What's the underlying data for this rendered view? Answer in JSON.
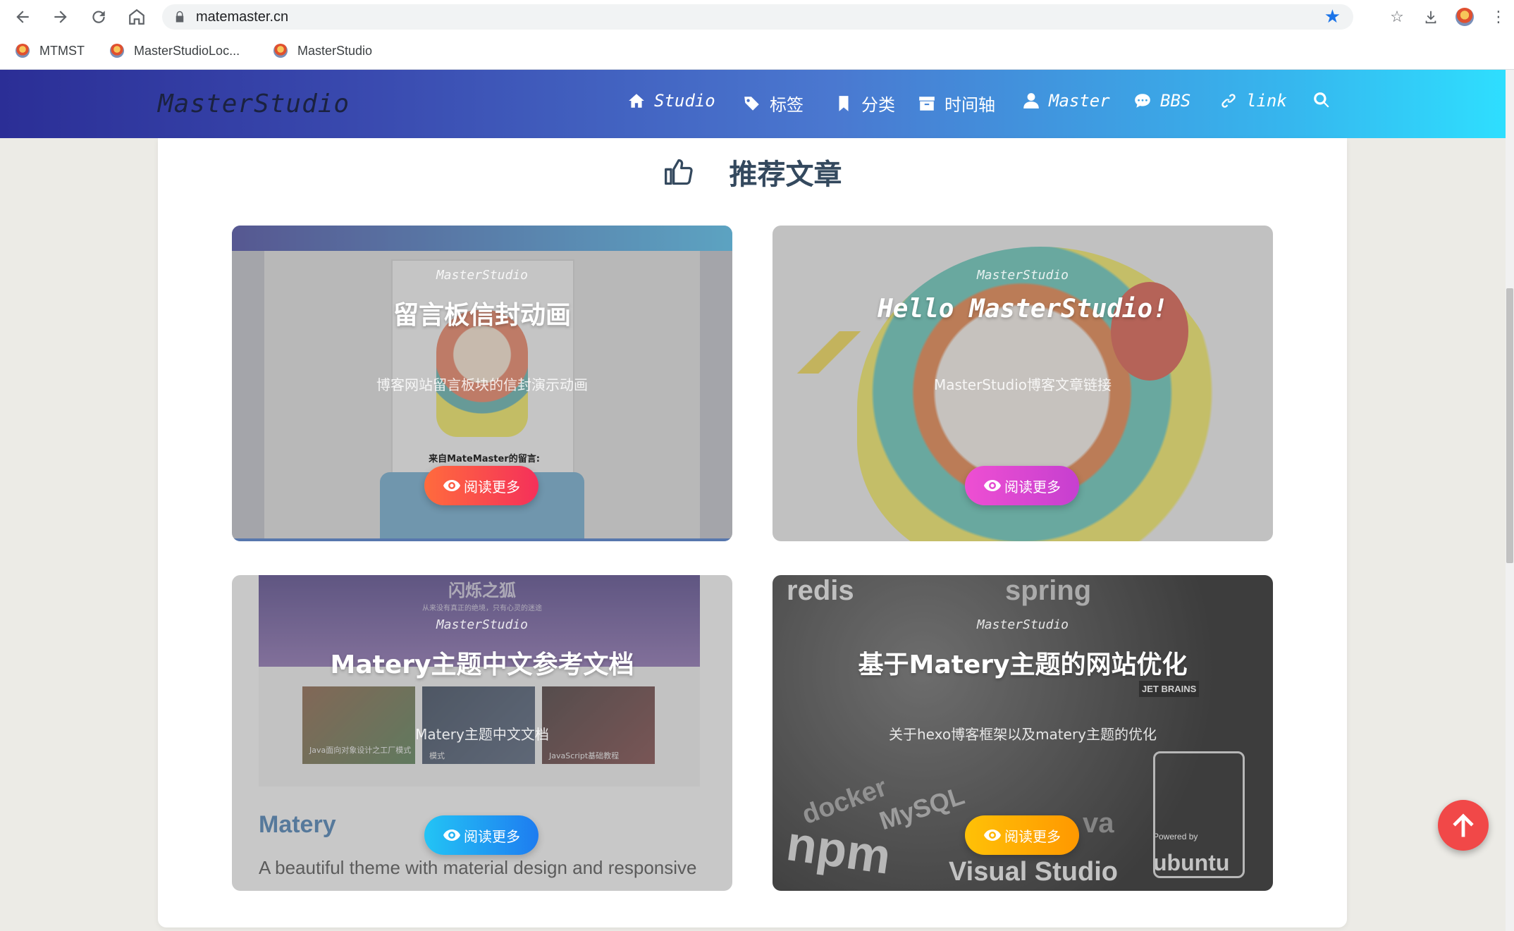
{
  "browser": {
    "url": "matemaster.cn",
    "bookmarks": [
      {
        "label": "MTMST"
      },
      {
        "label": "MasterStudioLoc..."
      },
      {
        "label": "MasterStudio"
      }
    ]
  },
  "site": {
    "logo": "MasterStudio",
    "nav": [
      {
        "label": "Studio",
        "icon": "home-icon"
      },
      {
        "label": "标签",
        "icon": "tags-icon"
      },
      {
        "label": "分类",
        "icon": "bookmark-icon"
      },
      {
        "label": "时间轴",
        "icon": "archive-icon"
      },
      {
        "label": "Master",
        "icon": "user-icon"
      },
      {
        "label": "BBS",
        "icon": "comments-icon"
      },
      {
        "label": "link",
        "icon": "link-icon"
      }
    ]
  },
  "section": {
    "title": "推荐文章",
    "icon": "thumbs-up-icon"
  },
  "articles": [
    {
      "site": "MasterStudio",
      "title": "留言板信封动画",
      "description": "博客网站留言板块的信封演示动画",
      "read_more": "阅读更多",
      "button_color": "#f5593d",
      "inner_caption": "来自MateMaster的留言:"
    },
    {
      "site": "MasterStudio",
      "title": "Hello MasterStudio!",
      "description": "MasterStudio博客文章链接",
      "read_more": "阅读更多",
      "button_color": "#e040c0"
    },
    {
      "site": "MasterStudio",
      "title": "Matery主题中文参考文档",
      "description": "Matery主题中文文档",
      "read_more": "阅读更多",
      "button_color": "#1ea7f5",
      "image_heading": "闪烁之狐",
      "image_subheading": "从来没有真正的绝境，只有心灵的迷途",
      "image_caption_title": "Matery",
      "image_caption_text": "A beautiful theme with material design and responsive",
      "image_thumb_captions": [
        "Java面向对象设计之工厂模式",
        "模式",
        "JavaScript基础教程"
      ]
    },
    {
      "site": "MasterStudio",
      "title": "基于Matery主题的网站优化",
      "description": "关于hexo博客框架以及matery主题的优化",
      "read_more": "阅读更多",
      "button_color": "#ffb300",
      "image_stickers": [
        "redis",
        "spring",
        "docker",
        "MySQL",
        "npm",
        "Visual Studio",
        "ubuntu",
        "JET BRAINS",
        "Powered by",
        "va"
      ]
    }
  ],
  "colors": {
    "header_start": "#2b2e96",
    "header_end": "#2ee0ff",
    "back_to_top": "#f14848"
  }
}
